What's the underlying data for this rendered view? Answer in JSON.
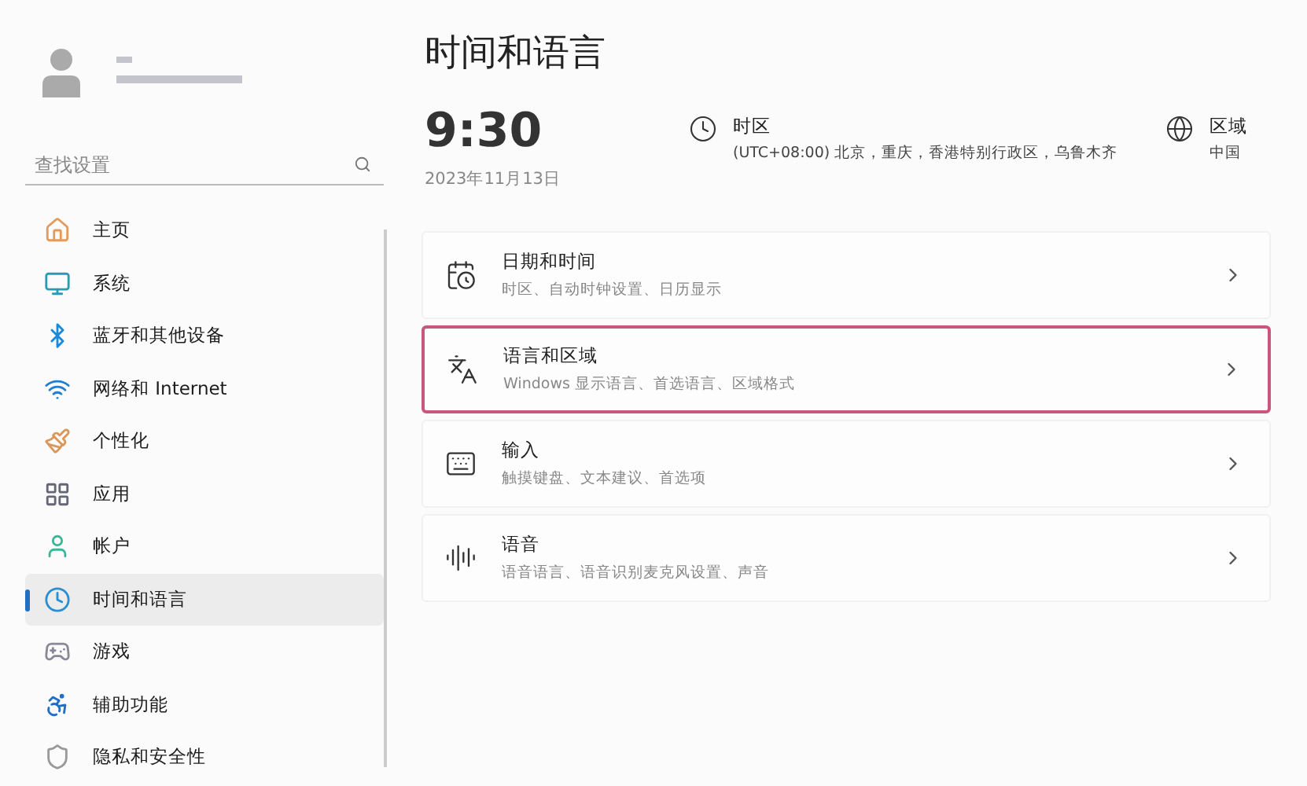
{
  "sidebar": {
    "search": {
      "placeholder": "查找设置"
    },
    "items": [
      {
        "label": "主页",
        "selected": false
      },
      {
        "label": "系统",
        "selected": false
      },
      {
        "label": "蓝牙和其他设备",
        "selected": false
      },
      {
        "label": "网络和 Internet",
        "selected": false
      },
      {
        "label": "个性化",
        "selected": false
      },
      {
        "label": "应用",
        "selected": false
      },
      {
        "label": "帐户",
        "selected": false
      },
      {
        "label": "时间和语言",
        "selected": true
      },
      {
        "label": "游戏",
        "selected": false
      },
      {
        "label": "辅助功能",
        "selected": false
      },
      {
        "label": "隐私和安全性",
        "selected": false
      }
    ]
  },
  "page": {
    "title": "时间和语言",
    "clock": {
      "time": "9:30",
      "date": "2023年11月13日"
    },
    "timezone": {
      "title": "时区",
      "value": "(UTC+08:00) 北京，重庆，香港特别行政区，乌鲁木齐"
    },
    "region": {
      "title": "区域",
      "value": "中国"
    },
    "cards": [
      {
        "title": "日期和时间",
        "subtitle": "时区、自动时钟设置、日历显示",
        "selected": false
      },
      {
        "title": "语言和区域",
        "subtitle": "Windows 显示语言、首选语言、区域格式",
        "selected": true
      },
      {
        "title": "输入",
        "subtitle": "触摸键盘、文本建议、首选项",
        "selected": false
      },
      {
        "title": "语音",
        "subtitle": "语音语言、语音识别麦克风设置、声音",
        "selected": false
      }
    ]
  }
}
